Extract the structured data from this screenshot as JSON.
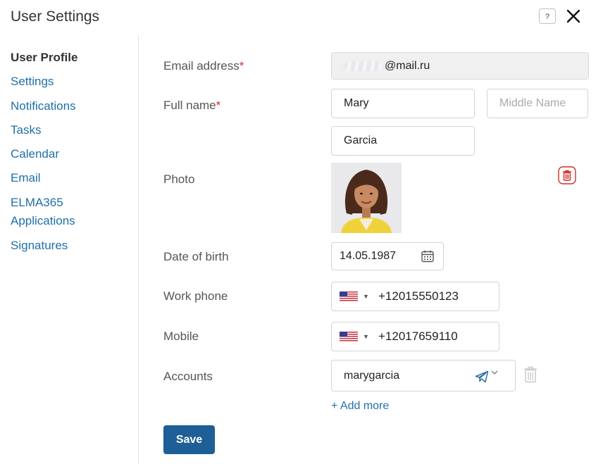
{
  "dialog": {
    "title": "User Settings",
    "help_label": "?"
  },
  "sidebar": {
    "items": [
      {
        "label": "User Profile",
        "active": true
      },
      {
        "label": "Settings"
      },
      {
        "label": "Notifications"
      },
      {
        "label": "Tasks"
      },
      {
        "label": "Calendar"
      },
      {
        "label": "Email"
      },
      {
        "label": "ELMA365 Applications"
      },
      {
        "label": "Signatures"
      }
    ]
  },
  "form": {
    "email": {
      "label": "Email address",
      "required_mark": "*",
      "value_domain": "@mail.ru"
    },
    "full_name": {
      "label": "Full name",
      "required_mark": "*",
      "first_name": "Mary",
      "middle_name_placeholder": "Middle Name",
      "last_name": "Garcia"
    },
    "photo": {
      "label": "Photo"
    },
    "date_of_birth": {
      "label": "Date of birth",
      "value": "14.05.1987"
    },
    "work_phone": {
      "label": "Work phone",
      "country": "US",
      "value": "+12015550123"
    },
    "mobile": {
      "label": "Mobile",
      "country": "US",
      "value": "+12017659110"
    },
    "accounts": {
      "label": "Accounts",
      "value": "marygarcia",
      "messenger_icon": "telegram-icon"
    },
    "add_more_label": "+ Add more",
    "save_label": "Save"
  },
  "colors": {
    "link": "#1f6fa9",
    "primary_button": "#1d5f96",
    "required": "#d32f2f",
    "delete_icon": "#d32f2f"
  }
}
